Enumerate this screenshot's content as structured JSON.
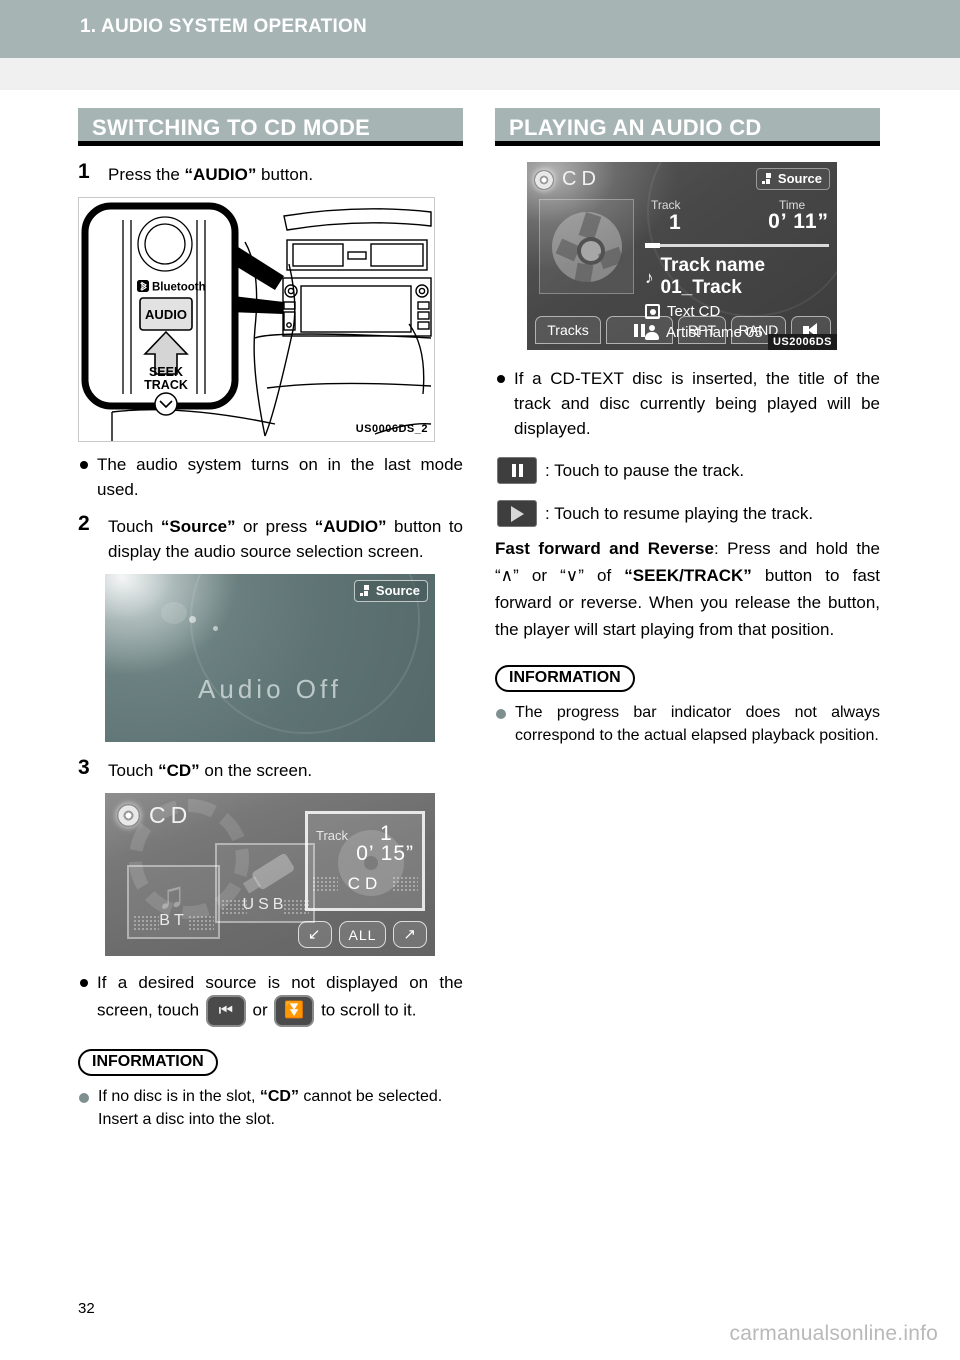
{
  "header": {
    "chapter_title": "1. AUDIO SYSTEM OPERATION"
  },
  "sections": {
    "left_heading": "SWITCHING TO CD MODE",
    "right_heading": "PLAYING AN AUDIO CD"
  },
  "left_column": {
    "step1": {
      "num": "1",
      "text_pre": "Press the ",
      "text_bold": "“AUDIO”",
      "text_post": " button."
    },
    "figure1": {
      "code": "US0006DS_2",
      "labels": {
        "bluetooth": "Bluetooth",
        "audio": "AUDIO",
        "seek": "SEEK",
        "track": "TRACK"
      }
    },
    "bullet1": "The audio system turns on in the last mode used.",
    "step2": {
      "num": "2",
      "t1": "Touch ",
      "b1": "“Source”",
      "t2": " or press ",
      "b2": "“AUDIO”",
      "t3": " button to display the audio source selection screen."
    },
    "screen_audio_off": {
      "title": "Audio Off",
      "source_button": "Source"
    },
    "step3": {
      "num": "3",
      "t1": "Touch ",
      "b1": "“CD”",
      "t2": " on the screen."
    },
    "screen_source_select": {
      "header_label": "CD",
      "cards": [
        {
          "label": "BT"
        },
        {
          "label": "USB"
        },
        {
          "label": "CD"
        }
      ],
      "cd_card": {
        "track_label": "Track",
        "track_value": "1",
        "time_value": "0’ 15”",
        "mini_label": "CD"
      },
      "pills": {
        "scroll_back": "↙",
        "all": "ALL",
        "scroll_fwd": "↗"
      }
    },
    "bullet2": {
      "t1": "If a desired source is not displayed on the screen, touch ",
      "t2": " or ",
      "t3": " to scroll to it."
    },
    "information": {
      "title": "INFORMATION",
      "item_t1": "If no disc is in the slot, ",
      "item_b1": "“CD”",
      "item_t2": " cannot be selected. Insert a disc into the slot."
    }
  },
  "right_column": {
    "screen_cd_play": {
      "code": "US2006DS",
      "header_label": "CD",
      "source_button": "Source",
      "track_label": "Track",
      "track_value": "1",
      "time_label": "Time",
      "time_value": "0’ 11”",
      "progress_percent": 8,
      "track_name": "Track name 01_Track",
      "disc_title": "Text CD",
      "artist_name": "Artist name 05",
      "buttons": {
        "tracks": "Tracks",
        "pause": "",
        "rpt": "RPT",
        "rand": "RAND",
        "volume": ""
      }
    },
    "bullet1": "If a CD-TEXT disc is inserted, the title of the track and disc currently being played will be displayed.",
    "pause_line": ": Touch to pause the track.",
    "play_line": ": Touch to resume playing the track.",
    "fast_forward": {
      "b1": "Fast forward and Reverse",
      "t1": ": Press and hold the “∧” or “∨” of ",
      "b2": "“SEEK/TRACK”",
      "t2": " button to fast forward or reverse. When you release the button, the player will start playing from that position."
    },
    "information": {
      "title": "INFORMATION",
      "item": "The progress bar indicator does not always correspond to the actual elapsed playback position."
    }
  },
  "footer": {
    "page_number": "32",
    "watermark": "carmanualsonline.info"
  },
  "colors": {
    "band": "#a7b4b4",
    "subband": "#f0f0f0",
    "heading_rule": "#000000",
    "info_bullet": "#7e8f8f"
  }
}
